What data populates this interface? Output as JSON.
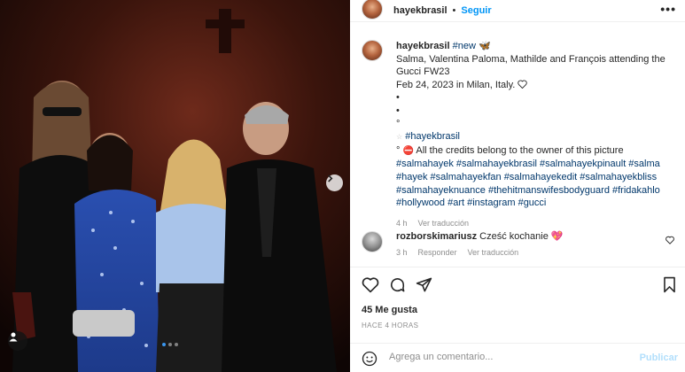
{
  "post": {
    "username": "hayekbrasil",
    "follow_label": "Seguir",
    "header_separator": "•",
    "more_label": "•••",
    "image_description_alt": ""
  },
  "caption": {
    "username": "hayekbrasil",
    "hashtag_new": "#new",
    "emoji_butterfly": "🦋",
    "line_text": "Salma, Valentina Paloma, Mathilde and François attending the Gucci FW23",
    "date_place": "Feb 24, 2023 in Milan, Italy.",
    "bullet1": "•",
    "bullet2": "•",
    "bullet3": "°",
    "star_tag_prefix": "☆",
    "tag_hayekbrasil": "#hayekbrasil",
    "credit_prefix": "°",
    "credit_icon": "⛔",
    "credit_text": "All the credits belong to the owner of this picture",
    "hashtags": "#salmahayek #salmahayekbrasil #salmahayekpinault #salma #hayek #salmahayekfan #salmahayekedit #salmahayekbliss #salmahayeknuance #thehitmanswifesbodyguard #fridakahlo #hollywood #art #instagram #gucci",
    "time": "4 h",
    "see_translation": "Ver traducción"
  },
  "comment": {
    "username": "rozborskimariusz",
    "text": "Cześć kochanie",
    "emoji": "💖",
    "time": "3 h",
    "reply_label": "Responder",
    "see_translation": "Ver traducción"
  },
  "actions": {
    "likes": "45 Me gusta",
    "posted_ago": "HACE 4 HORAS"
  },
  "add_comment": {
    "placeholder": "Agrega un comentario...",
    "post_label": "Publicar"
  },
  "colors": {
    "link_blue": "#0095f6",
    "hashtag_blue": "#00376b",
    "muted": "#8e8e8e",
    "carousel_active": "#3a97f0",
    "heart_red": "#ed4956"
  },
  "icons": [
    "chevron-right-icon",
    "user-tag-icon",
    "heart-icon",
    "comment-icon",
    "share-icon",
    "bookmark-icon",
    "emoji-icon",
    "more-icon",
    "heart-outline-icon"
  ]
}
